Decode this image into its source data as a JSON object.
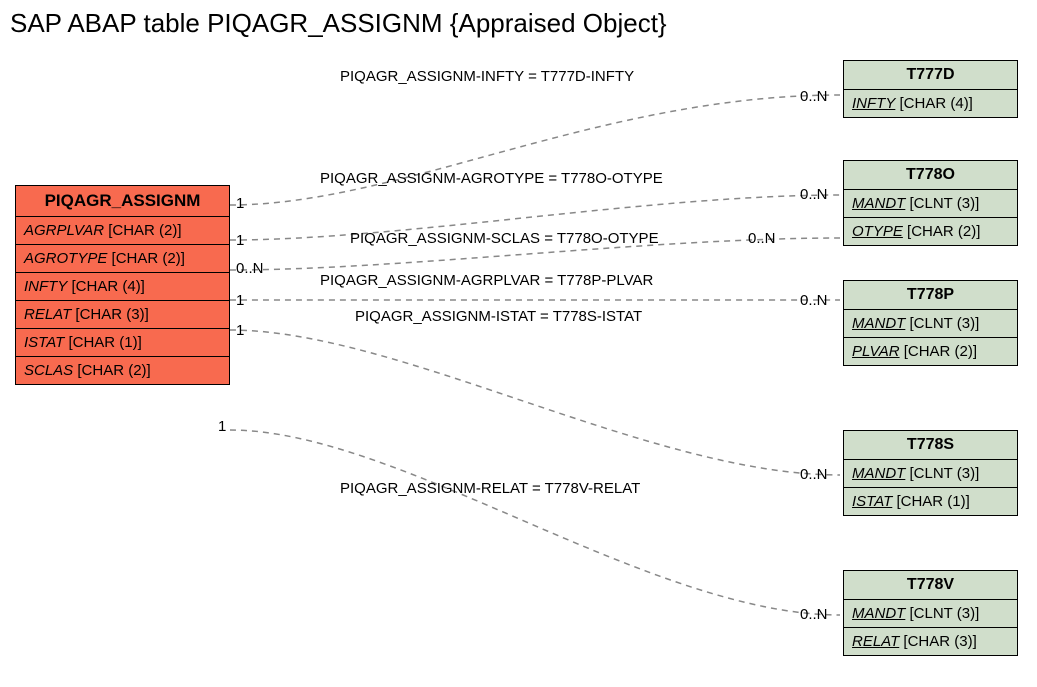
{
  "title": "SAP ABAP table PIQAGR_ASSIGNM {Appraised Object}",
  "main_entity": {
    "name": "PIQAGR_ASSIGNM",
    "fields": [
      {
        "name": "AGRPLVAR",
        "type": "[CHAR (2)]"
      },
      {
        "name": "AGROTYPE",
        "type": "[CHAR (2)]"
      },
      {
        "name": "INFTY",
        "type": "[CHAR (4)]"
      },
      {
        "name": "RELAT",
        "type": "[CHAR (3)]"
      },
      {
        "name": "ISTAT",
        "type": "[CHAR (1)]"
      },
      {
        "name": "SCLAS",
        "type": "[CHAR (2)]"
      }
    ]
  },
  "ref_entities": [
    {
      "name": "T777D",
      "fields": [
        {
          "name": "INFTY",
          "type": "[CHAR (4)]"
        }
      ]
    },
    {
      "name": "T778O",
      "fields": [
        {
          "name": "MANDT",
          "type": "[CLNT (3)]"
        },
        {
          "name": "OTYPE",
          "type": "[CHAR (2)]"
        }
      ]
    },
    {
      "name": "T778P",
      "fields": [
        {
          "name": "MANDT",
          "type": "[CLNT (3)]"
        },
        {
          "name": "PLVAR",
          "type": "[CHAR (2)]"
        }
      ]
    },
    {
      "name": "T778S",
      "fields": [
        {
          "name": "MANDT",
          "type": "[CLNT (3)]"
        },
        {
          "name": "ISTAT",
          "type": "[CHAR (1)]"
        }
      ]
    },
    {
      "name": "T778V",
      "fields": [
        {
          "name": "MANDT",
          "type": "[CLNT (3)]"
        },
        {
          "name": "RELAT",
          "type": "[CHAR (3)]"
        }
      ]
    }
  ],
  "relations": [
    {
      "label": "PIQAGR_ASSIGNM-INFTY = T777D-INFTY"
    },
    {
      "label": "PIQAGR_ASSIGNM-AGROTYPE = T778O-OTYPE"
    },
    {
      "label": "PIQAGR_ASSIGNM-SCLAS = T778O-OTYPE"
    },
    {
      "label": "PIQAGR_ASSIGNM-AGRPLVAR = T778P-PLVAR"
    },
    {
      "label": "PIQAGR_ASSIGNM-ISTAT = T778S-ISTAT"
    },
    {
      "label": "PIQAGR_ASSIGNM-RELAT = T778V-RELAT"
    }
  ],
  "cardinality": {
    "one": "1",
    "zero_n": "0..N"
  }
}
